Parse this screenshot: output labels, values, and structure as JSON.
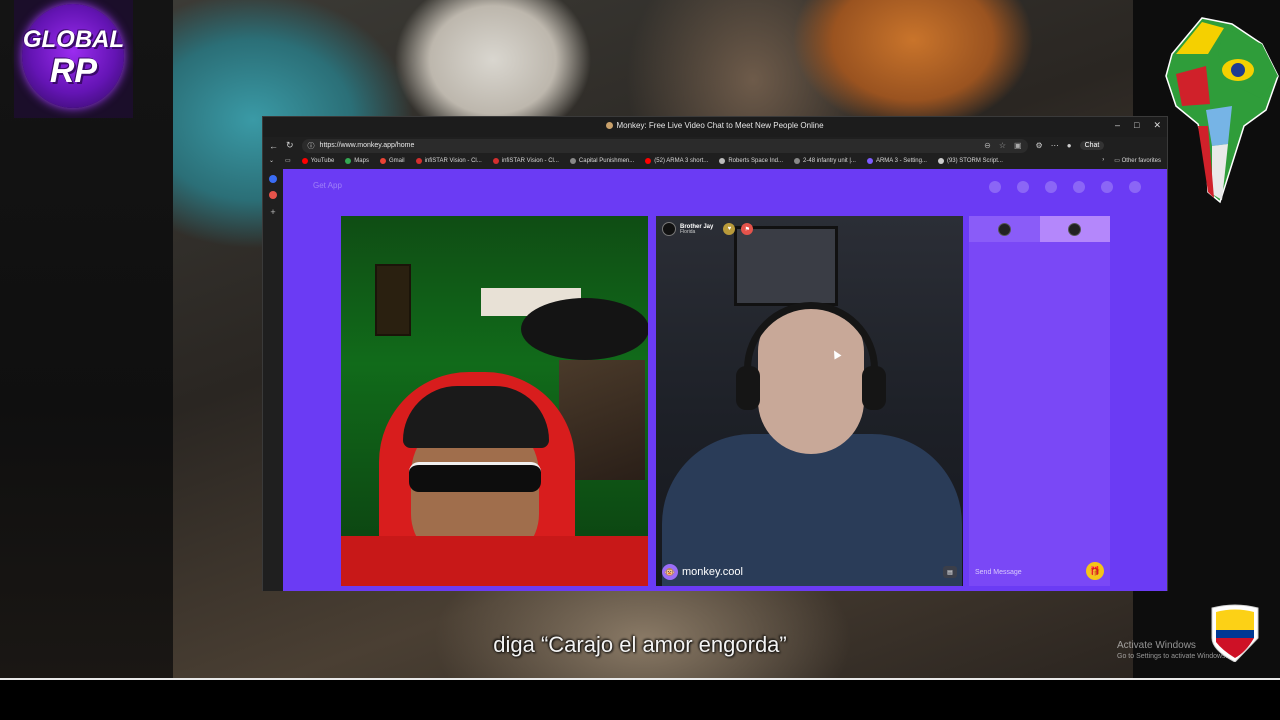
{
  "logo": {
    "line1": "GLOBAL",
    "line2": "RP"
  },
  "browser": {
    "title": "Monkey: Free Live Video Chat to Meet New People Online",
    "url": "https://www.monkey.app/home",
    "chat_button": "Chat",
    "window_controls": {
      "minimize": "–",
      "maximize": "□",
      "close": "✕"
    },
    "favorites": [
      {
        "label": "YouTube",
        "color": "#ff0000"
      },
      {
        "label": "Maps",
        "color": "#34a853"
      },
      {
        "label": "Gmail",
        "color": "#ea4335"
      },
      {
        "label": "infiSTAR Vision - Cl...",
        "color": "#d32f2f"
      },
      {
        "label": "infiSTAR Vision - Cl...",
        "color": "#d32f2f"
      },
      {
        "label": "Capital Punishmen...",
        "color": "#888888"
      },
      {
        "label": "(52) ARMA 3 short...",
        "color": "#ff0000"
      },
      {
        "label": "Roberts Space Ind...",
        "color": "#bbbbbb"
      },
      {
        "label": "2-48 infantry unit |...",
        "color": "#888888"
      },
      {
        "label": "ARMA 3 - Setting...",
        "color": "#7d5cff"
      },
      {
        "label": "(93) STORM Script...",
        "color": "#cccccc"
      }
    ],
    "other_favorites": "Other favorites"
  },
  "page": {
    "get_app": "Get App",
    "peer": {
      "name": "Brother Jay",
      "location": "Florida"
    },
    "brand": "monkey.cool",
    "chat_placeholder": "Send Message"
  },
  "subtitle": "diga “Carajo el amor engorda”",
  "watermark": {
    "line1": "Activate Windows",
    "line2": "Go to Settings to activate Windows."
  },
  "colors": {
    "accent": "#6b3bf4",
    "hood": "#d81d1d",
    "gift": "#f5c518"
  }
}
